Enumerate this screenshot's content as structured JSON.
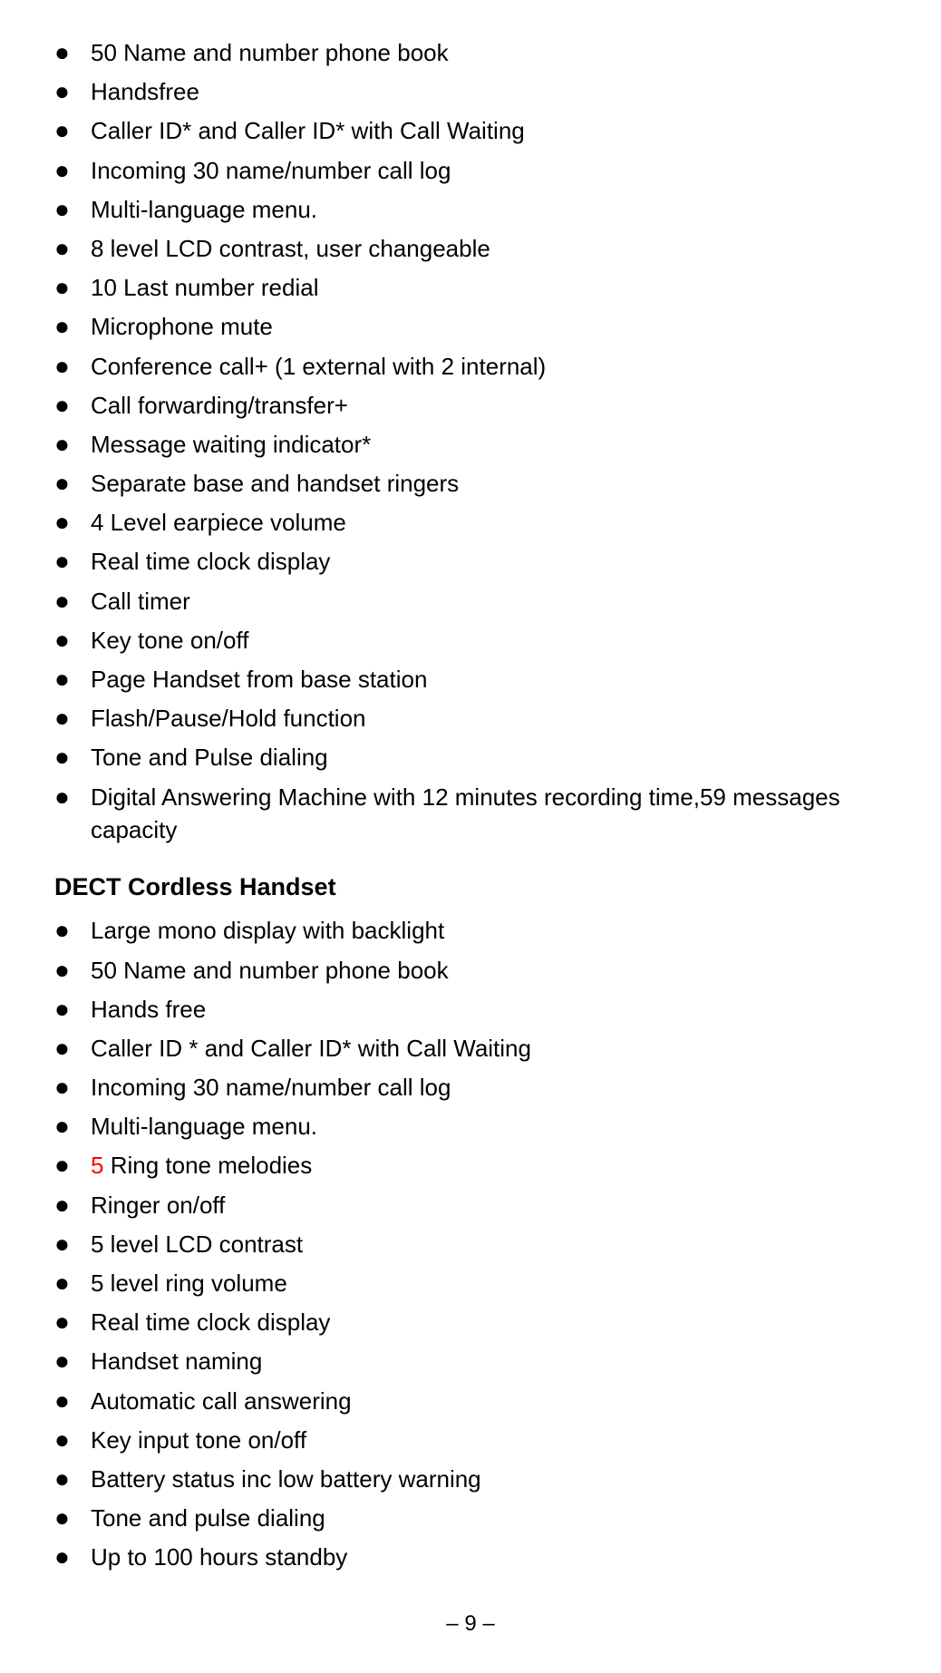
{
  "base_list": {
    "items": [
      "50 Name and number phone book",
      "Handsfree",
      "Caller ID* and Caller ID* with Call Waiting",
      "Incoming 30 name/number call log",
      "Multi-language menu.",
      "8 level LCD contrast, user changeable",
      "10 Last number redial",
      "Microphone mute",
      "Conference call+ (1 external with 2 internal)",
      "Call forwarding/transfer+",
      "Message waiting indicator*",
      "Separate base and handset ringers",
      "4 Level earpiece volume",
      "Real time clock display",
      "Call timer",
      "Key tone on/off",
      "Page Handset from base station",
      "Flash/Pause/Hold function",
      "Tone and Pulse dialing",
      "Digital  Answering  Machine  with  12  minutes  recording  time,59 messages capacity"
    ]
  },
  "section_header": {
    "prefix": "DECT",
    "title": " Cordless Handset"
  },
  "handset_list": {
    "items": [
      {
        "text": "Large mono display with backlight",
        "red_prefix": ""
      },
      {
        "text": "50 Name and number phone book",
        "red_prefix": ""
      },
      {
        "text": "Hands free",
        "red_prefix": ""
      },
      {
        "text": "Caller ID * and Caller ID* with Call Waiting",
        "red_prefix": ""
      },
      {
        "text": "Incoming 30 name/number call log",
        "red_prefix": ""
      },
      {
        "text": "Multi-language menu.",
        "red_prefix": ""
      },
      {
        "text": " Ring tone melodies",
        "red_prefix": "5"
      },
      {
        "text": "Ringer on/off",
        "red_prefix": ""
      },
      {
        "text": "5 level LCD contrast",
        "red_prefix": ""
      },
      {
        "text": "5 level ring volume",
        "red_prefix": ""
      },
      {
        "text": "Real time clock display",
        "red_prefix": ""
      },
      {
        "text": "Handset naming",
        "red_prefix": ""
      },
      {
        "text": "Automatic call answering",
        "red_prefix": ""
      },
      {
        "text": "Key input tone on/off",
        "red_prefix": ""
      },
      {
        "text": "Battery status inc low battery warning",
        "red_prefix": ""
      },
      {
        "text": "Tone and pulse dialing",
        "red_prefix": ""
      },
      {
        "text": "Up to 100 hours standby",
        "red_prefix": ""
      }
    ]
  },
  "page_number": "– 9 –",
  "bullet_char": "●"
}
